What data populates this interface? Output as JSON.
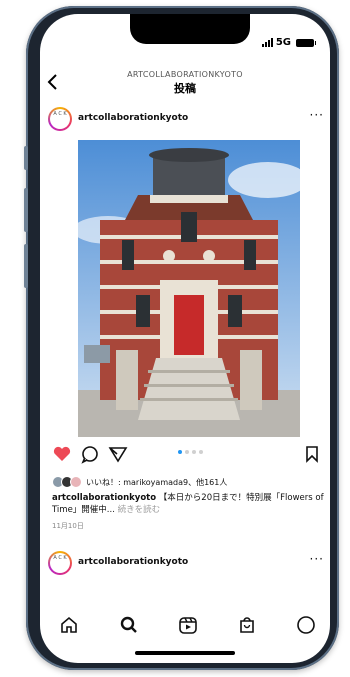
{
  "status": {
    "network": "5G"
  },
  "header": {
    "subtitle": "ARTCOLLABORATIONKYOTO",
    "title": "投稿",
    "back_icon": "chevron-left-icon"
  },
  "post": {
    "username": "artcollaborationkyoto",
    "more": "···",
    "avatar_text": "A C K",
    "carousel": {
      "total": 4,
      "current": 1
    },
    "likes_text": "いいね！: marikoyamada9、他161人",
    "caption_user": "artcollaborationkyoto",
    "caption_text": "【本日から20日まで！特別展「Flowers of Time」開催中...",
    "caption_more": "続きを読む",
    "date": "11月10日",
    "liked": true
  },
  "next_post": {
    "username": "artcollaborationkyoto",
    "more": "···"
  },
  "tabbar": {
    "items": [
      "home-icon",
      "search-icon",
      "reels-icon",
      "shop-icon",
      "profile-icon"
    ]
  },
  "colors": {
    "like": "#ed4956",
    "dot_active": "#2196f3",
    "frame": "#1d2530"
  }
}
